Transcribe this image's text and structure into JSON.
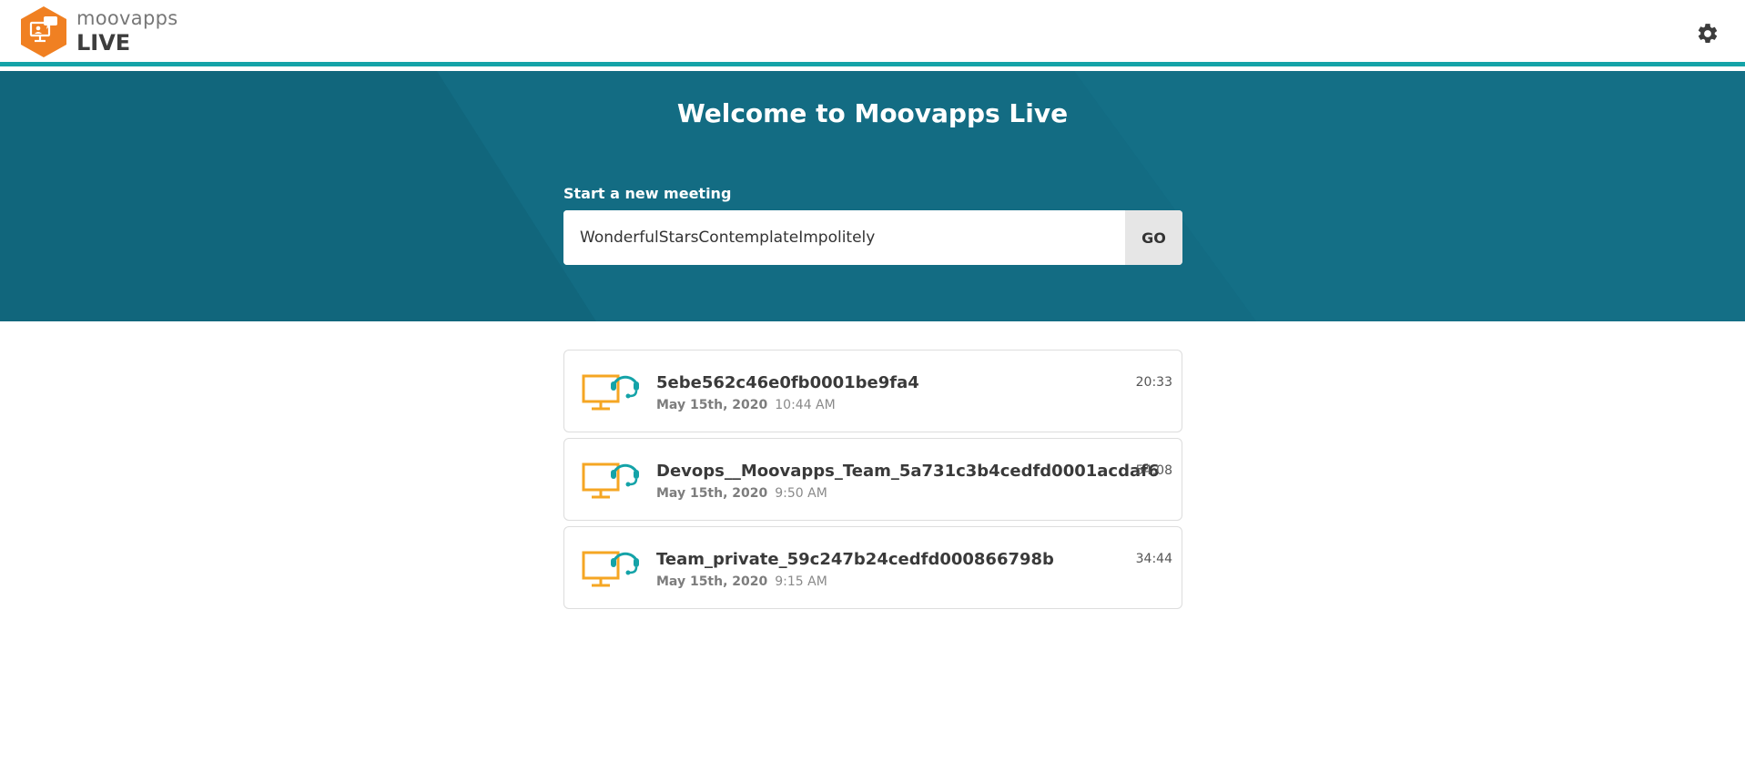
{
  "brand": {
    "name_top": "moovapps",
    "name_bottom": "LIVE",
    "logo_color": "#f08022"
  },
  "header": {
    "settings_icon": "gear-icon",
    "accent_color": "#14a3a8"
  },
  "hero": {
    "title": "Welcome to Moovapps Live",
    "start_label": "Start a new meeting",
    "input_value": "WonderfulStarsContemplateImpolitely",
    "go_label": "GO",
    "background_color": "#136c83"
  },
  "meetings": [
    {
      "name": "5ebe562c46e0fb0001be9fa4",
      "date": "May 15th, 2020",
      "time": "10:44 AM",
      "duration": "20:33"
    },
    {
      "name": "Devops__Moovapps_Team_5a731c3b4cedfd0001acdaf6",
      "date": "May 15th, 2020",
      "time": "9:50 AM",
      "duration": "54:08"
    },
    {
      "name": "Team_private_59c247b24cedfd000866798b",
      "date": "May 15th, 2020",
      "time": "9:15 AM",
      "duration": "34:44"
    }
  ],
  "icons": {
    "meeting_icon": "monitor-headset-icon",
    "monitor_color": "#f5a623",
    "headset_color": "#14a3a8"
  }
}
